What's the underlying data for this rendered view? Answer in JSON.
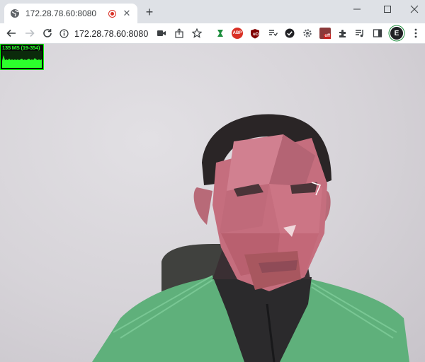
{
  "browser": {
    "tab_title": "172.28.78.60:8080",
    "address": "172.28.78.60:8080",
    "profile_initial": "E",
    "extensions": [
      {
        "name": "extension-green-icon",
        "color": "#1e8e3e"
      },
      {
        "name": "adblock-icon",
        "label": "ABP",
        "color": "#d93025"
      },
      {
        "name": "ublock-icon",
        "color": "#800000"
      },
      {
        "name": "extension-list-icon",
        "color": "#5f6368"
      },
      {
        "name": "check-circle-icon",
        "color": "#202124"
      },
      {
        "name": "gear-icon",
        "color": "#5f6368"
      },
      {
        "name": "toggle-extension-icon",
        "label": "off",
        "color": "#c5221f"
      },
      {
        "name": "puzzle-icon",
        "color": "#5f6368"
      }
    ]
  },
  "overlay": {
    "stats_text": "135 MS (19-354)"
  },
  "colors": {
    "tabstrip": "#dee1e6",
    "stats_green": "#2cff2c",
    "shirt": "#5fb07b",
    "face": "#c56e7e"
  }
}
